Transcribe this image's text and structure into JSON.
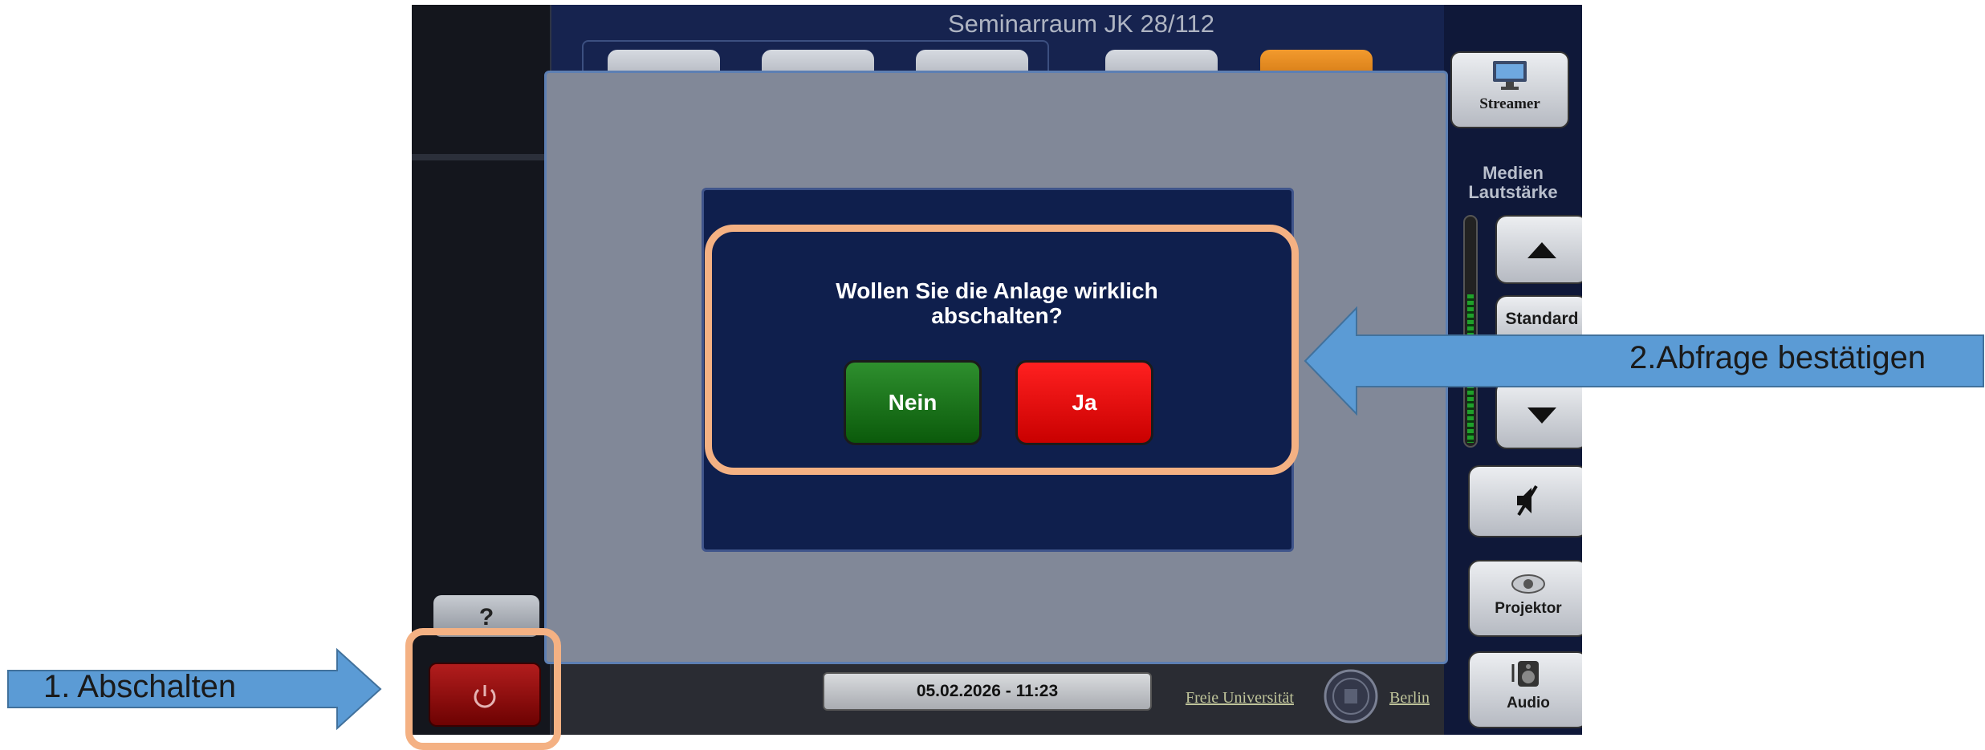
{
  "room_title": "Seminarraum JK 28/112",
  "top_buttons": {
    "streamer": "Streamer"
  },
  "volume": {
    "label_line1": "Medien",
    "label_line2": "Lautstärke",
    "standard_label": "Standard"
  },
  "side_buttons": {
    "projektor": "Projektor",
    "audio": "Audio"
  },
  "help_label": "?",
  "datetime": "05.02.2026  -  11:23",
  "logo": {
    "left": "Freie Universität",
    "right": "Berlin"
  },
  "dialog": {
    "prompt_line1": "Wollen Sie die Anlage wirklich",
    "prompt_line2": "abschalten?",
    "no_label": "Nein",
    "yes_label": "Ja"
  },
  "annotations": {
    "step1": "1. Abschalten",
    "step2": "2.Abfrage bestätigen",
    "highlight_color": "#f4b183",
    "arrow_color": "#5b9bd5"
  },
  "colors": {
    "confirm_yes": "#ff0000",
    "confirm_no": "#1f7a1f",
    "power": "#8b0000"
  }
}
